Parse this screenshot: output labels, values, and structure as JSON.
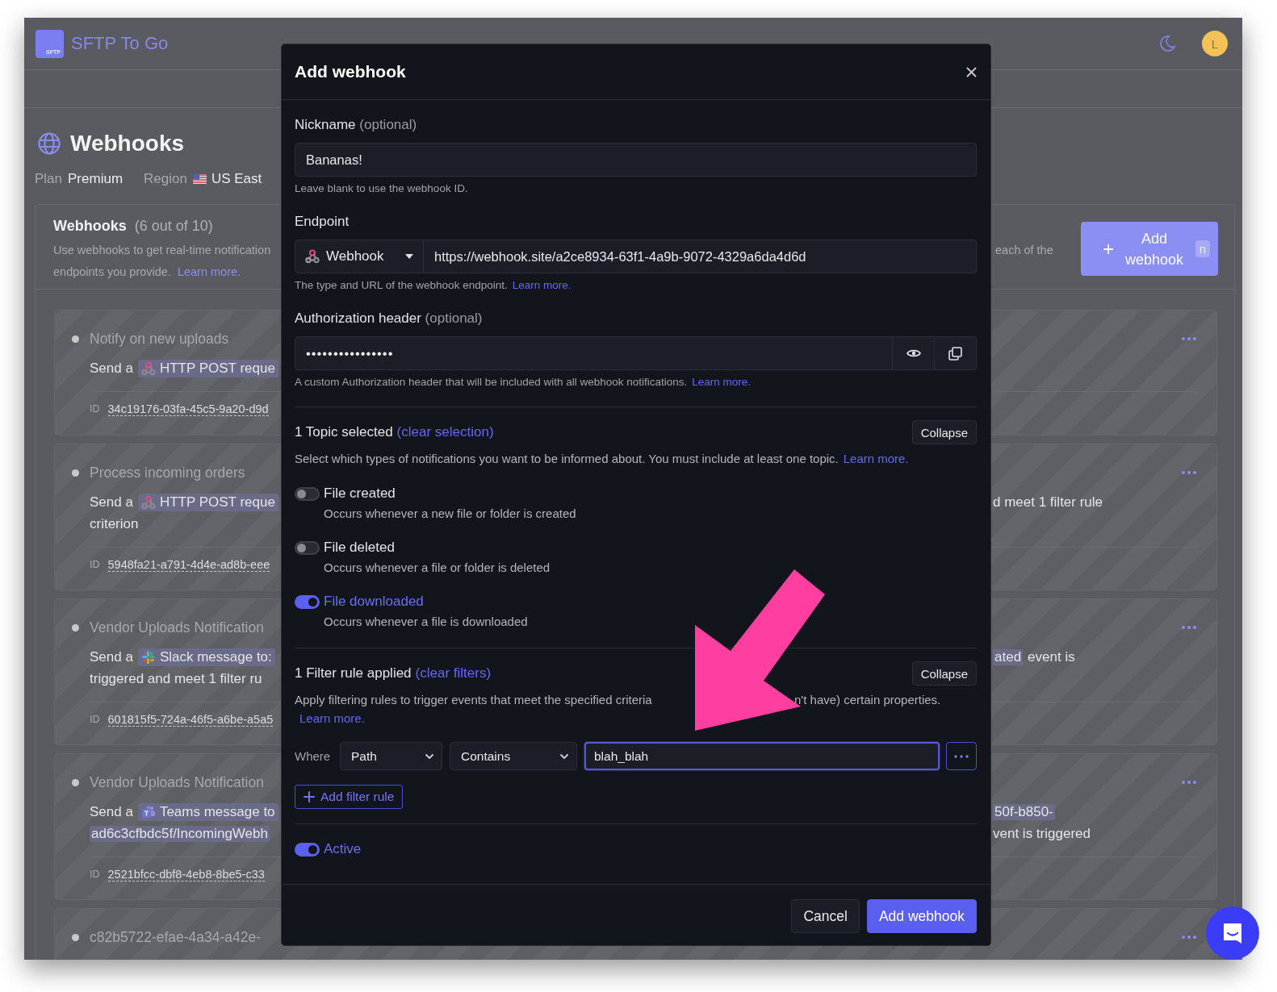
{
  "app": {
    "logo_text": "SFTP",
    "title": "SFTP To Go",
    "avatar": "L"
  },
  "page": {
    "title": "Webhooks",
    "plan_label": "Plan",
    "plan": "Premium",
    "region_label": "Region",
    "region": "US East"
  },
  "panel": {
    "title": "Webhooks",
    "count": "(6 out of 10)",
    "description": [
      "Use webhooks to get real-time notification",
      "endpoints you provide."
    ],
    "description_right": "each of the",
    "learn_more": "Learn more.",
    "add_button": "Add webhook",
    "shortcut": "n"
  },
  "webhooks": [
    {
      "name": "Notify on new uploads",
      "send": "Send a",
      "channel": {
        "kind": "webhook",
        "label": "HTTP POST reque"
      },
      "id_label": "ID",
      "id": "34c19176-03fa-45c5-9a20-d9d"
    },
    {
      "name": "Process incoming orders",
      "send": "Send a",
      "channel": {
        "kind": "webhook",
        "label": "HTTP POST reque"
      },
      "lines": [
        {
          "text": "criterion",
          "highlight": false
        }
      ],
      "right": [
        [
          {
            "text": "d meet 1 filter rule",
            "highlight": false
          }
        ]
      ],
      "id_label": "ID",
      "id": "5948fa21-a791-4d4e-ad8b-eee"
    },
    {
      "name": "Vendor Uploads Notification",
      "send": "Send a",
      "channel": {
        "kind": "slack",
        "label": "Slack message to:"
      },
      "lines": [
        {
          "text": "triggered and meet 1 filter ru",
          "highlight": false
        }
      ],
      "right": [
        [
          {
            "text": "ated",
            "highlight": true
          },
          {
            "text": "event is",
            "highlight": false
          }
        ]
      ],
      "id_label": "ID",
      "id": "601815f5-724a-46f5-a6be-a5a5"
    },
    {
      "name": "Vendor Uploads Notification",
      "send": "Send a",
      "channel": {
        "kind": "teams",
        "label": "Teams message to"
      },
      "lines": [
        {
          "text": "ad6c3cfbdc5f/IncomingWebh",
          "highlight": true
        }
      ],
      "right": [
        [
          {
            "text": "50f-b850-",
            "highlight": true
          }
        ],
        [
          {
            "text": "vent is triggered",
            "highlight": false
          }
        ]
      ],
      "id_label": "ID",
      "id": "2521bfcc-dbf8-4eb8-8be5-c33"
    },
    {
      "name": "c82b5722-efae-4a34-a42e-"
    }
  ],
  "modal": {
    "title": "Add webhook",
    "nickname": {
      "label": "Nickname",
      "optional": "(optional)",
      "value": "Bananas!",
      "hint": "Leave blank to use the webhook ID."
    },
    "endpoint": {
      "label": "Endpoint",
      "type": "Webhook",
      "url": "https://webhook.site/a2ce8934-63f1-4a9b-9072-4329a6da4d6d",
      "hint": "The type and URL of the webhook endpoint.",
      "learn_more": "Learn more."
    },
    "authorization": {
      "label": "Authorization header",
      "optional": "(optional)",
      "value": "••••••••••••••••",
      "hint": "A custom Authorization header that will be included with all webhook notifications.",
      "learn_more": "Learn more."
    },
    "topics": {
      "summary": "1 Topic selected",
      "clear": "(clear selection)",
      "collapse": "Collapse",
      "description": "Select which types of notifications you want to be informed about. You must include at least one topic.",
      "learn_more": "Learn more.",
      "items": [
        {
          "label": "File created",
          "description": "Occurs whenever a new file or folder is created",
          "on": false
        },
        {
          "label": "File deleted",
          "description": "Occurs whenever a file or folder is deleted",
          "on": false
        },
        {
          "label": "File downloaded",
          "description": "Occurs whenever a file is downloaded",
          "on": true
        }
      ]
    },
    "filters": {
      "summary": "1 Filter rule applied",
      "clear": "(clear filters)",
      "collapse": "Collapse",
      "description": [
        "Apply filtering rules to trigger events that meet the specified criteria",
        "n't have) certain properties."
      ],
      "learn_more": "Learn more.",
      "rules": [
        {
          "where": "Where",
          "field": "Path",
          "operator": "Contains",
          "value": "blah_blah",
          "focused": true
        }
      ],
      "add_rule": "Add filter rule"
    },
    "active": {
      "label": "Active",
      "on": true
    },
    "buttons": [
      {
        "label": "Cancel",
        "kind": "secondary"
      },
      {
        "label": "Add webhook",
        "kind": "primary"
      }
    ]
  }
}
